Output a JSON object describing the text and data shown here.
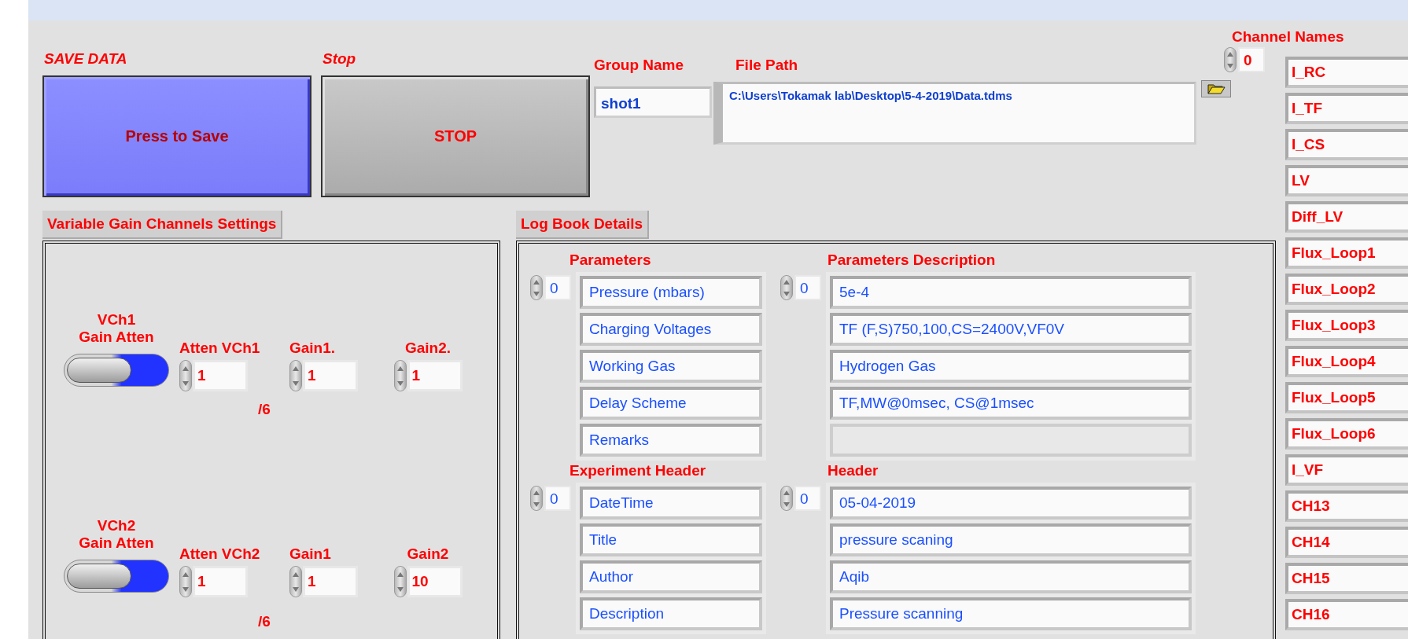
{
  "save": {
    "caption": "SAVE DATA",
    "label": "Press to Save"
  },
  "stop": {
    "caption": "Stop",
    "label": "STOP"
  },
  "group_name": {
    "label": "Group Name",
    "value": "shot1"
  },
  "file_path": {
    "label": "File Path",
    "value": "C:\\Users\\Tokamak lab\\Desktop\\5-4-2019\\Data.tdms"
  },
  "variable_gain": {
    "title": "Variable Gain Channels Settings",
    "channels": [
      {
        "name": "VCh1",
        "switch_label": "Gain Atten",
        "on": false,
        "atten_label": "Atten VCh1",
        "atten": "1",
        "divisor": "/6",
        "gain1_label": "Gain1.",
        "gain1": "1",
        "gain2_label": "Gain2.",
        "gain2": "1"
      },
      {
        "name": "VCh2",
        "switch_label": "Gain Atten",
        "on": false,
        "atten_label": "Atten VCh2",
        "atten": "1",
        "divisor": "/6",
        "gain1_label": "Gain1",
        "gain1": "1",
        "gain2_label": "Gain2",
        "gain2": "10"
      }
    ]
  },
  "log_book": {
    "title": "Log Book Details",
    "sections": [
      {
        "left": {
          "label": "Parameters",
          "index": "0",
          "items": [
            "Pressure (mbars)",
            "Charging Voltages",
            "Working Gas",
            "Delay Scheme",
            "Remarks"
          ]
        },
        "right": {
          "label": "Parameters Description",
          "index": "0",
          "items": [
            "5e-4",
            "TF (F,S)750,100,CS=2400V,VF0V",
            "Hydrogen Gas",
            "TF,MW@0msec, CS@1msec"
          ]
        }
      },
      {
        "left": {
          "label": "Experiment Header",
          "index": "0",
          "items": [
            "DateTime",
            "Title",
            "Author",
            "Description"
          ]
        },
        "right": {
          "label": "Header",
          "index": "0",
          "items": [
            "05-04-2019",
            "pressure scaning",
            "Aqib",
            "Pressure scanning"
          ]
        }
      }
    ]
  },
  "channel_names": {
    "label": "Channel Names",
    "index": "0",
    "items": [
      "I_RC",
      "I_TF",
      "I_CS",
      "LV",
      "Diff_LV",
      "Flux_Loop1",
      "Flux_Loop2",
      "Flux_Loop3",
      "Flux_Loop4",
      "Flux_Loop5",
      "Flux_Loop6",
      "I_VF",
      "CH13",
      "CH14",
      "CH15",
      "CH16"
    ]
  }
}
